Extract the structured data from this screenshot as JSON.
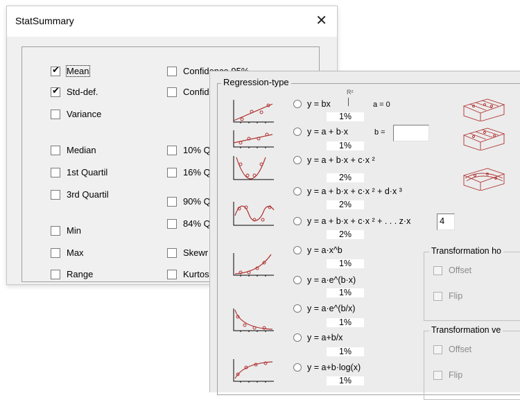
{
  "stat_window": {
    "title": "StatSummary",
    "close_glyph": "✕",
    "checkboxes_left": [
      {
        "label": "Mean",
        "checked": true
      },
      {
        "label": "Std-def.",
        "checked": true
      },
      {
        "label": "Variance",
        "checked": false
      },
      {
        "label": "Median",
        "checked": false
      },
      {
        "label": "1st Quartil",
        "checked": false
      },
      {
        "label": "3rd Quartil",
        "checked": false
      },
      {
        "label": "Min",
        "checked": false
      },
      {
        "label": "Max",
        "checked": false
      },
      {
        "label": "Range",
        "checked": false
      }
    ],
    "checkboxes_right": [
      {
        "label": "Confidence 95%",
        "checked": false
      },
      {
        "label": "Confid",
        "checked": false
      },
      {
        "label": "10% Q",
        "checked": false
      },
      {
        "label": "16% Q",
        "checked": false
      },
      {
        "label": "90% Q",
        "checked": false
      },
      {
        "label": "84% Q",
        "checked": false
      },
      {
        "label": "Skewr",
        "checked": false
      },
      {
        "label": "Kurtos",
        "checked": false
      }
    ]
  },
  "regression_window": {
    "group_title": "Regression-type",
    "options": [
      {
        "formula": "y = bx",
        "percent": "1%"
      },
      {
        "formula": "y = a + b·x",
        "percent": "1%"
      },
      {
        "formula": "y = a + b·x + c·x ²",
        "percent": "2%"
      },
      {
        "formula": "y = a + b·x + c·x ² + d·x ³",
        "percent": "2%"
      },
      {
        "formula": "y = a + b·x + c·x ² + . . . z·x",
        "percent": "2%"
      },
      {
        "formula": "y = a·x^b",
        "percent": "1%"
      },
      {
        "formula": "y = a·e^(b·x)",
        "percent": "1%"
      },
      {
        "formula": "y = a·e^(b/x)",
        "percent": "1%"
      },
      {
        "formula": "y = a+b/x",
        "percent": "1%"
      },
      {
        "formula": "y = a+b·log(x)",
        "percent": "1%"
      }
    ],
    "r2_label": "R²",
    "a_zero_label": "a = 0",
    "b_label": "b =",
    "b_value": "",
    "poly_degree": "4",
    "transform_h": {
      "title": "Transformation ho",
      "offset_label": "Offset",
      "flip_label": "Flip"
    },
    "transform_v": {
      "title": "Transformation ve",
      "offset_label": "Offset",
      "flip_label": "Flip"
    }
  },
  "colors": {
    "curve": "#b03030",
    "axis": "#000000",
    "window_bg": "#f0f0f0"
  }
}
